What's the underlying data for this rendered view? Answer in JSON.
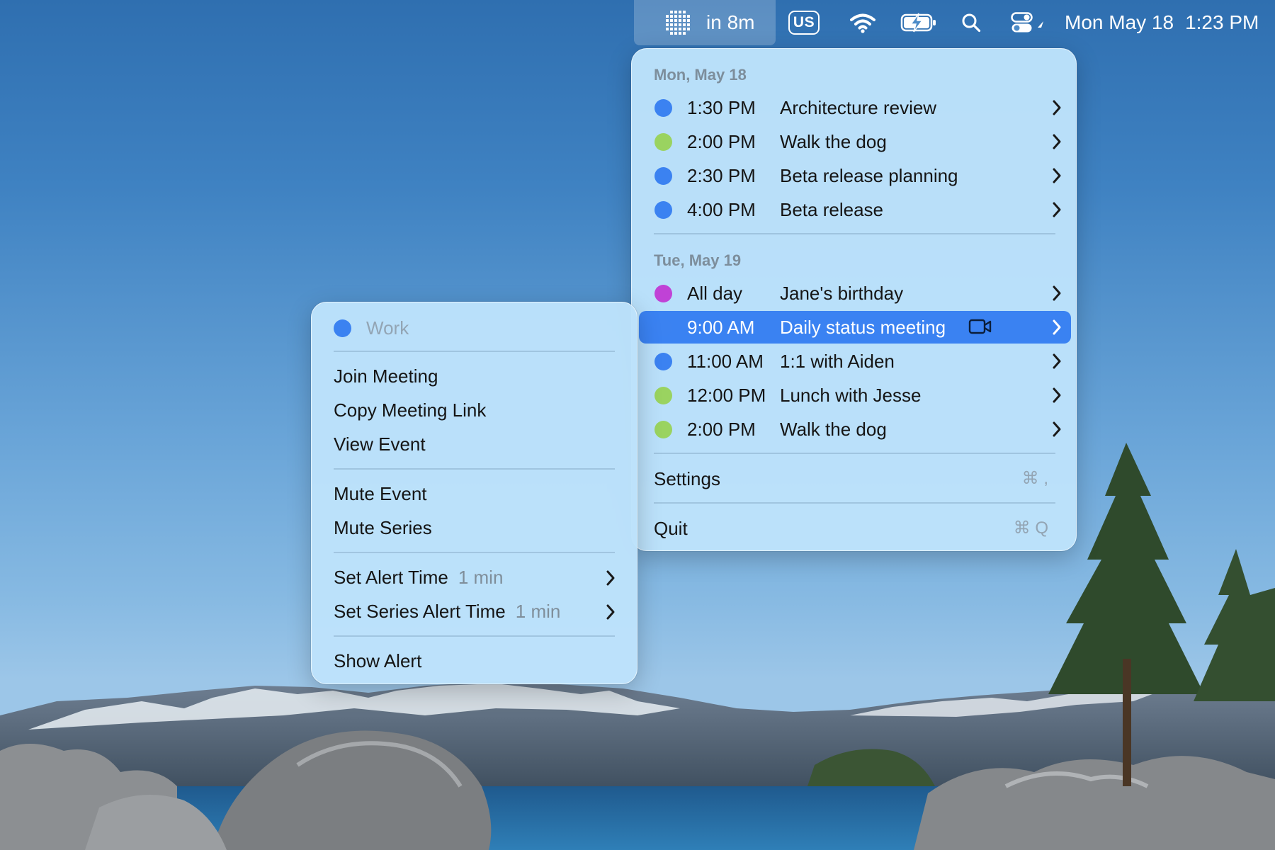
{
  "colors": {
    "work": "#3b82f1",
    "personal": "#9ad360",
    "birthday": "#c042d6",
    "selection": "#3a82f2"
  },
  "menubar": {
    "app_icon": "grid-calendar-icon",
    "app_label": "in 8m",
    "input_source": "US",
    "icons": [
      "wifi-icon",
      "battery-charging-icon",
      "search-icon",
      "control-center-icon"
    ],
    "date": "Mon May 18",
    "time": "1:23 PM"
  },
  "main_menu": {
    "sections": [
      {
        "header": "Mon, May 18",
        "events": [
          {
            "time": "1:30 PM",
            "title": "Architecture review",
            "calendar_color": "#3b82f1"
          },
          {
            "time": "2:00 PM",
            "title": "Walk the dog",
            "calendar_color": "#9ad360"
          },
          {
            "time": "2:30 PM",
            "title": "Beta release planning",
            "calendar_color": "#3b82f1"
          },
          {
            "time": "4:00 PM",
            "title": "Beta release",
            "calendar_color": "#3b82f1"
          }
        ]
      },
      {
        "header": "Tue, May 19",
        "events": [
          {
            "time": "All day",
            "title": "Jane's birthday",
            "calendar_color": "#c042d6"
          },
          {
            "time": "9:00 AM",
            "title": "Daily status meeting",
            "calendar_color": "#3b82f1",
            "selected": true,
            "has_video": true
          },
          {
            "time": "11:00 AM",
            "title": "1:1 with Aiden",
            "calendar_color": "#3b82f1"
          },
          {
            "time": "12:00 PM",
            "title": "Lunch with Jesse",
            "calendar_color": "#9ad360"
          },
          {
            "time": "2:00 PM",
            "title": "Walk the dog",
            "calendar_color": "#9ad360"
          }
        ]
      }
    ],
    "settings": {
      "label": "Settings",
      "shortcut": "⌘ ,"
    },
    "quit": {
      "label": "Quit",
      "shortcut": "⌘ Q"
    }
  },
  "submenu": {
    "calendar_name": "Work",
    "calendar_color": "#3b82f1",
    "join_meeting": "Join Meeting",
    "copy_link": "Copy Meeting Link",
    "view_event": "View Event",
    "mute_event": "Mute Event",
    "mute_series": "Mute Series",
    "set_alert_time": {
      "label": "Set Alert Time",
      "value": "1 min"
    },
    "set_series_alert_time": {
      "label": "Set Series Alert Time",
      "value": "1 min"
    },
    "show_alert": "Show Alert"
  }
}
